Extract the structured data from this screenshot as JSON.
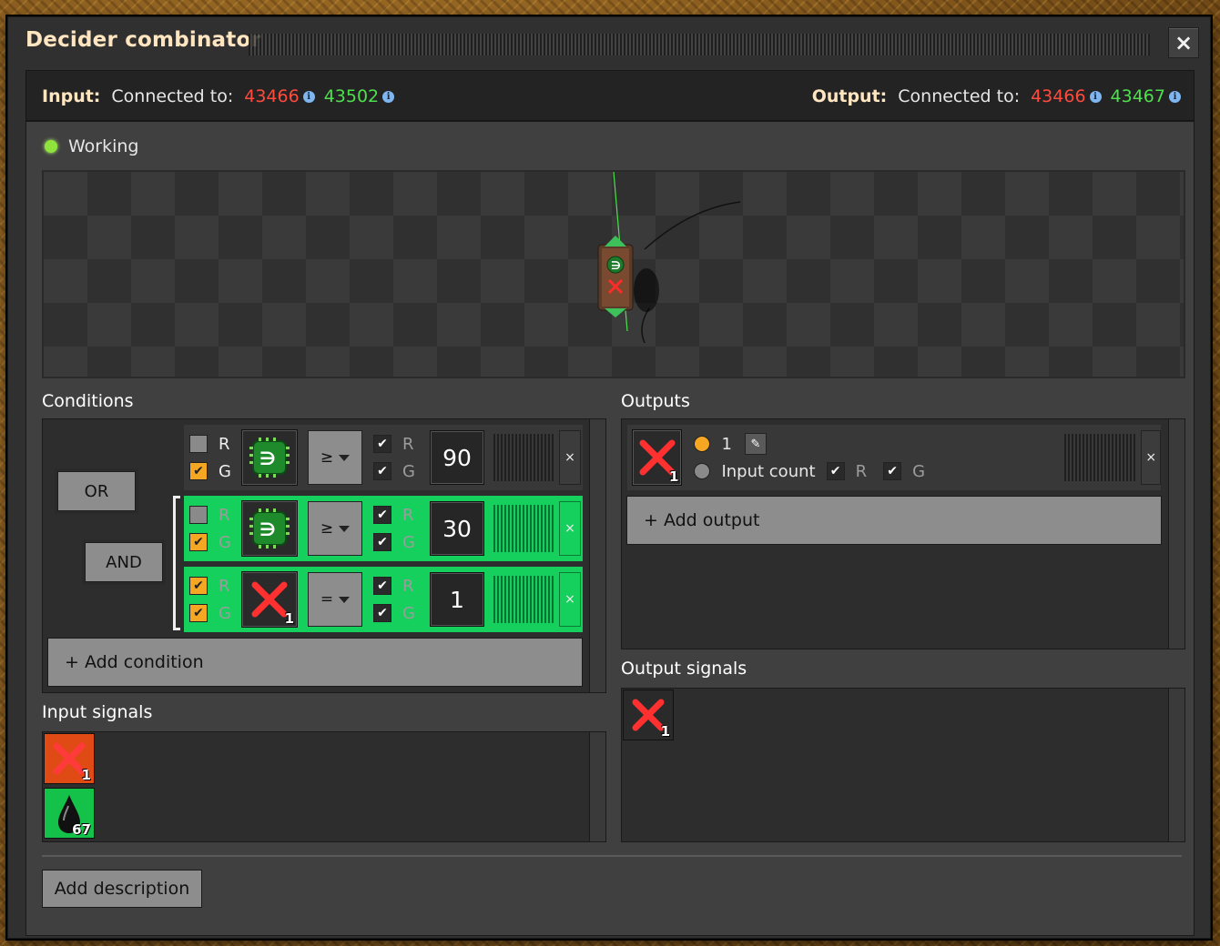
{
  "window": {
    "title": "Decider combinator",
    "close_label": "×"
  },
  "connections": {
    "input": {
      "label": "Input:",
      "connected_text": "Connected to:",
      "red_id": "43466",
      "green_id": "43502"
    },
    "output": {
      "label": "Output:",
      "connected_text": "Connected to:",
      "red_id": "43466",
      "green_id": "43467"
    },
    "info_glyph": "i"
  },
  "status": {
    "text": "Working"
  },
  "conditions": {
    "title": "Conditions",
    "or_label": "OR",
    "and_label": "AND",
    "rows": [
      {
        "red_checked": false,
        "green_checked": true,
        "r": "R",
        "g": "G",
        "signal_icon": "electronic-circuit-icon",
        "comparator": "≥",
        "right_r": "R",
        "right_g": "G",
        "constant": "90",
        "remove": "×",
        "active": false
      },
      {
        "red_checked": false,
        "green_checked": true,
        "r": "R",
        "g": "G",
        "signal_icon": "electronic-circuit-icon",
        "comparator": "≥",
        "right_r": "R",
        "right_g": "G",
        "constant": "30",
        "remove": "×",
        "active": true
      },
      {
        "red_checked": true,
        "green_checked": true,
        "r": "R",
        "g": "G",
        "signal_icon": "red-x-signal-icon",
        "signal_count": "1",
        "comparator": "=",
        "right_r": "R",
        "right_g": "G",
        "constant": "1",
        "remove": "×",
        "active": true
      }
    ],
    "add_label": "+ Add condition"
  },
  "outputs": {
    "title": "Outputs",
    "row": {
      "signal_icon": "red-x-signal-icon",
      "signal_count": "1",
      "value": "1",
      "input_count_label": "Input count",
      "r": "R",
      "g": "G",
      "remove": "×"
    },
    "add_label": "+ Add output"
  },
  "input_signals": {
    "title": "Input signals",
    "items": [
      {
        "icon": "red-x-signal-icon",
        "count": "1",
        "color": "#e04a14"
      },
      {
        "icon": "crude-oil-icon",
        "count": "67",
        "color": "#14c24a"
      }
    ]
  },
  "output_signals": {
    "title": "Output signals",
    "items": [
      {
        "icon": "red-x-signal-icon",
        "count": "1"
      }
    ]
  },
  "description_button": "Add description",
  "colors": {
    "red_wire": "#ff4b3e",
    "green_wire": "#4de04d",
    "active_row": "#16d05e",
    "accent_title": "#ffe6c0"
  }
}
